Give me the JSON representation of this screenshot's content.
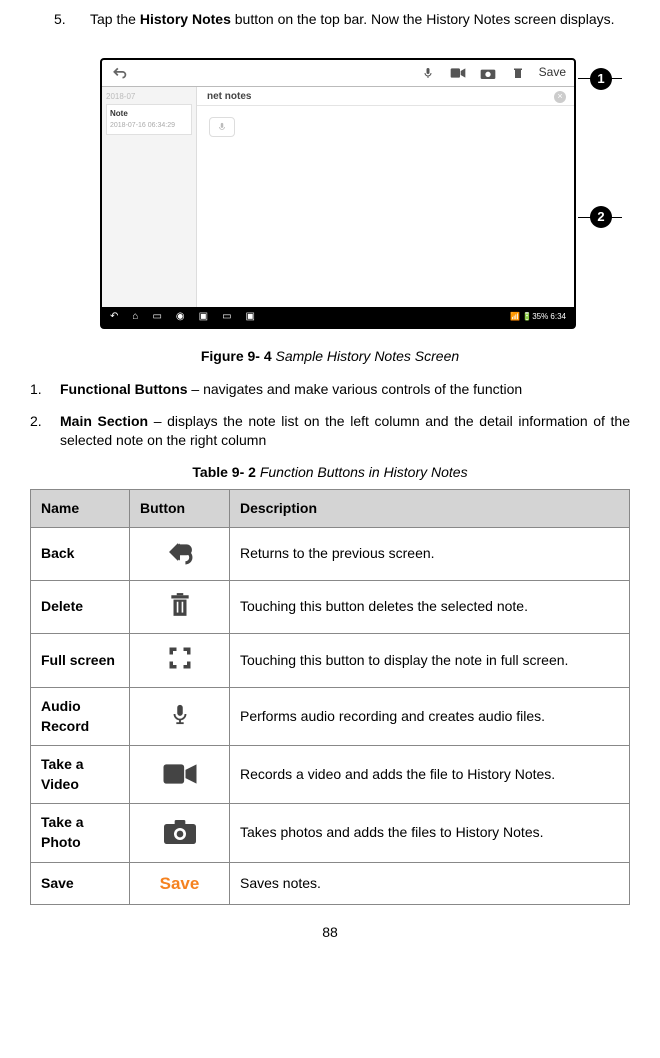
{
  "step5": {
    "num": "5.",
    "text_pre": "Tap the ",
    "text_bold": "History Notes",
    "text_post": " button on the top bar. Now the History Notes screen displays."
  },
  "screenshot": {
    "topbar": {
      "save": "Save"
    },
    "leftcol": {
      "month": "2018-07",
      "note_title": "Note",
      "note_date": "2018-07-16 06:34:29"
    },
    "rightcol": {
      "tab": "net notes"
    },
    "bottombar": {
      "stat": "35% 6:34"
    }
  },
  "callouts": {
    "c1": "1",
    "c2": "2"
  },
  "figcap": {
    "bold": "Figure 9- 4",
    "italic": " Sample History Notes Screen"
  },
  "item1": {
    "n": "1.",
    "bold": "Functional Buttons",
    "rest": " – navigates and make various controls of the function"
  },
  "item2": {
    "n": "2.",
    "bold": "Main Section",
    "rest": " – displays the note list on the left column and the detail information of the selected note on the right column"
  },
  "tablecap": {
    "bold": "Table 9- 2",
    "italic": " Function Buttons in History Notes"
  },
  "table": {
    "h1": "Name",
    "h2": "Button",
    "h3": "Description",
    "rows": [
      {
        "name": "Back",
        "desc": "Returns to the previous screen."
      },
      {
        "name": "Delete",
        "desc": "Touching this button deletes the selected note."
      },
      {
        "name": "Full screen",
        "desc": "Touching this button to display the note in full screen."
      },
      {
        "name": "Audio Record",
        "desc": "Performs audio recording and creates audio files."
      },
      {
        "name": "Take a Video",
        "desc": "Records a video and adds the file to History Notes."
      },
      {
        "name": "Take a Photo",
        "desc": "Takes photos and adds the files to History Notes."
      },
      {
        "name": "Save",
        "desc": "Saves notes."
      }
    ],
    "save_label": "Save"
  },
  "pagenum": "88"
}
